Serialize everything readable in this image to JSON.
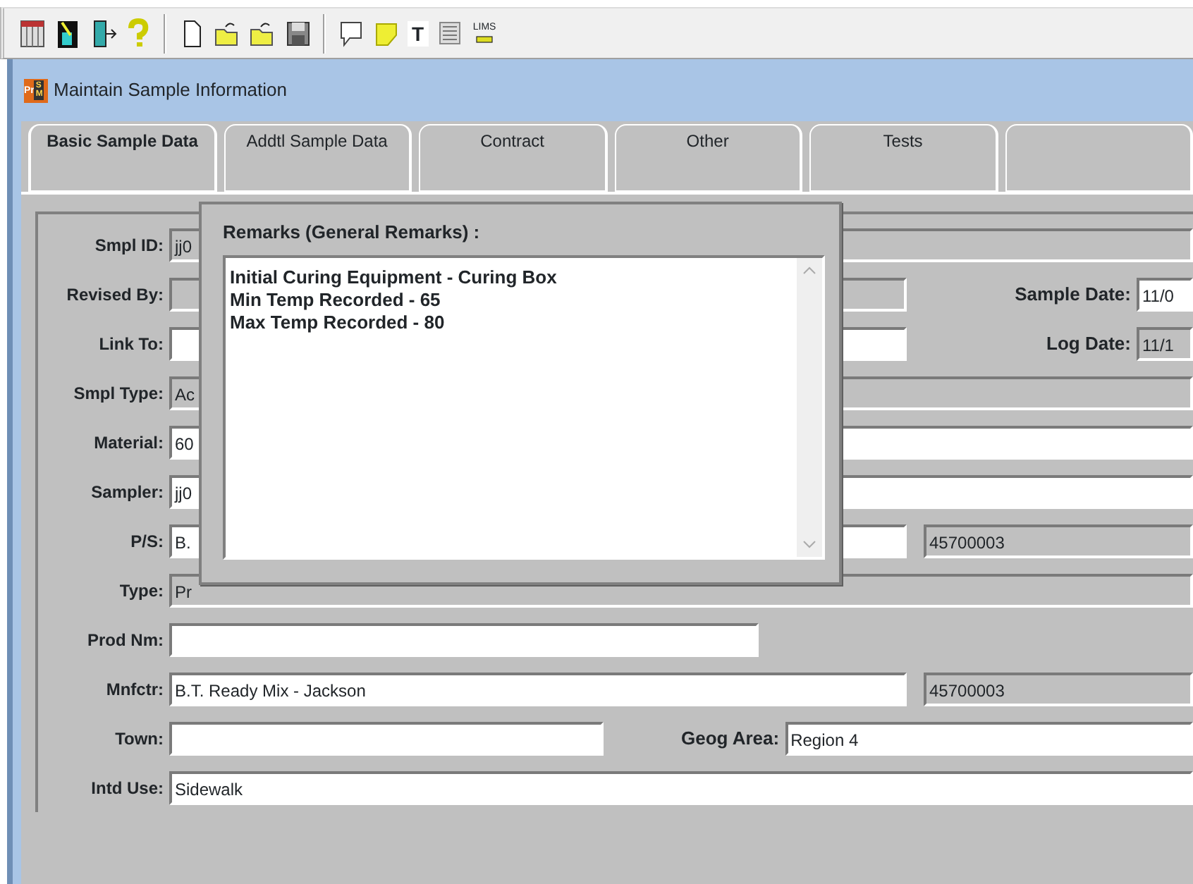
{
  "toolbar": [
    {
      "kind": "grid"
    },
    {
      "kind": "tool"
    },
    {
      "kind": "exit"
    },
    {
      "kind": "help"
    },
    {
      "kind": "sep"
    },
    {
      "kind": "new"
    },
    {
      "kind": "open"
    },
    {
      "kind": "open"
    },
    {
      "kind": "save"
    },
    {
      "kind": "sep"
    },
    {
      "kind": "bubble"
    },
    {
      "kind": "note"
    },
    {
      "kind": "text",
      "label": "T"
    },
    {
      "kind": "list"
    },
    {
      "kind": "lims",
      "label": "LIMS"
    }
  ],
  "window": {
    "logo": {
      "left": "Pr",
      "right": "SM"
    },
    "title": "Maintain Sample Information"
  },
  "tabs": [
    {
      "label": "Basic Sample Data",
      "selected": true
    },
    {
      "label": "Addtl Sample Data",
      "selected": false
    },
    {
      "label": "Contract",
      "selected": false
    },
    {
      "label": "Other",
      "selected": false
    },
    {
      "label": "Tests",
      "selected": false
    },
    {
      "selected": false
    }
  ],
  "form": [
    {
      "label": "Smpl ID:",
      "fields": [
        {
          "kind": "full",
          "editable": false,
          "value": "jj0"
        }
      ]
    },
    {
      "label": "Revised By:",
      "fields": [
        {
          "kind": "long",
          "editable": false
        }
      ],
      "extra": {
        "label": "Sample Date:",
        "editable": true,
        "value": "11/0"
      }
    },
    {
      "label": "Link To:",
      "fields": [
        {
          "kind": "long",
          "editable": true
        }
      ],
      "extra": {
        "label": "Log Date:",
        "editable": false,
        "value": "11/1"
      }
    },
    {
      "label": "Smpl Type:",
      "fields": [
        {
          "kind": "full",
          "editable": false,
          "value": "Ac"
        }
      ]
    },
    {
      "label": "Material:",
      "fields": [
        {
          "kind": "full",
          "editable": true,
          "value": "60"
        }
      ]
    },
    {
      "label": "Sampler:",
      "fields": [
        {
          "kind": "full",
          "editable": true,
          "value": "jj0"
        }
      ]
    },
    {
      "label": "P/S:",
      "fields": [
        {
          "kind": "long",
          "editable": true,
          "value": "B."
        },
        {
          "kind": "code",
          "editable": false,
          "value": "45700003"
        }
      ]
    },
    {
      "label": "Type:",
      "fields": [
        {
          "kind": "full",
          "editable": false,
          "value": "Pr"
        }
      ]
    },
    {
      "label": "Prod Nm:",
      "fields": [
        {
          "kind": "medium",
          "editable": true
        }
      ]
    },
    {
      "label": "Mnfctr:",
      "fields": [
        {
          "kind": "long",
          "editable": true,
          "value": "B.T. Ready Mix - Jackson"
        },
        {
          "kind": "code",
          "editable": false,
          "value": "45700003"
        }
      ]
    },
    {
      "label": "Town:",
      "fields": [
        {
          "kind": "half",
          "editable": true
        }
      ],
      "extra": {
        "label": "Geog Area:",
        "editable": true,
        "value": "Region 4",
        "kind": "wide"
      }
    },
    {
      "label": "Intd Use:",
      "fields": [
        {
          "kind": "full",
          "editable": true,
          "value": "Sidewalk"
        }
      ]
    }
  ],
  "remarks_popup": {
    "title": "Remarks (General Remarks) :",
    "lines": [
      "Initial Curing Equipment - Curing Box",
      "Min Temp Recorded - 65",
      "Max Temp Recorded - 80"
    ]
  }
}
